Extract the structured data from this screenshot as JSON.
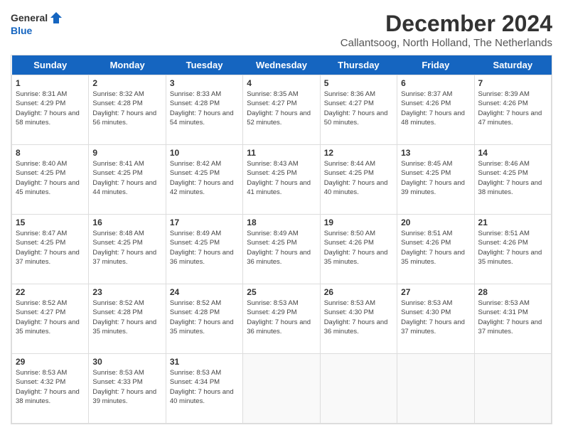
{
  "logo": {
    "general": "General",
    "blue": "Blue"
  },
  "title": "December 2024",
  "subtitle": "Callantsoog, North Holland, The Netherlands",
  "headers": [
    "Sunday",
    "Monday",
    "Tuesday",
    "Wednesday",
    "Thursday",
    "Friday",
    "Saturday"
  ],
  "weeks": [
    [
      {
        "day": "1",
        "sunrise": "8:31 AM",
        "sunset": "4:29 PM",
        "daylight": "7 hours and 58 minutes."
      },
      {
        "day": "2",
        "sunrise": "8:32 AM",
        "sunset": "4:28 PM",
        "daylight": "7 hours and 56 minutes."
      },
      {
        "day": "3",
        "sunrise": "8:33 AM",
        "sunset": "4:28 PM",
        "daylight": "7 hours and 54 minutes."
      },
      {
        "day": "4",
        "sunrise": "8:35 AM",
        "sunset": "4:27 PM",
        "daylight": "7 hours and 52 minutes."
      },
      {
        "day": "5",
        "sunrise": "8:36 AM",
        "sunset": "4:27 PM",
        "daylight": "7 hours and 50 minutes."
      },
      {
        "day": "6",
        "sunrise": "8:37 AM",
        "sunset": "4:26 PM",
        "daylight": "7 hours and 48 minutes."
      },
      {
        "day": "7",
        "sunrise": "8:39 AM",
        "sunset": "4:26 PM",
        "daylight": "7 hours and 47 minutes."
      }
    ],
    [
      {
        "day": "8",
        "sunrise": "8:40 AM",
        "sunset": "4:25 PM",
        "daylight": "7 hours and 45 minutes."
      },
      {
        "day": "9",
        "sunrise": "8:41 AM",
        "sunset": "4:25 PM",
        "daylight": "7 hours and 44 minutes."
      },
      {
        "day": "10",
        "sunrise": "8:42 AM",
        "sunset": "4:25 PM",
        "daylight": "7 hours and 42 minutes."
      },
      {
        "day": "11",
        "sunrise": "8:43 AM",
        "sunset": "4:25 PM",
        "daylight": "7 hours and 41 minutes."
      },
      {
        "day": "12",
        "sunrise": "8:44 AM",
        "sunset": "4:25 PM",
        "daylight": "7 hours and 40 minutes."
      },
      {
        "day": "13",
        "sunrise": "8:45 AM",
        "sunset": "4:25 PM",
        "daylight": "7 hours and 39 minutes."
      },
      {
        "day": "14",
        "sunrise": "8:46 AM",
        "sunset": "4:25 PM",
        "daylight": "7 hours and 38 minutes."
      }
    ],
    [
      {
        "day": "15",
        "sunrise": "8:47 AM",
        "sunset": "4:25 PM",
        "daylight": "7 hours and 37 minutes."
      },
      {
        "day": "16",
        "sunrise": "8:48 AM",
        "sunset": "4:25 PM",
        "daylight": "7 hours and 37 minutes."
      },
      {
        "day": "17",
        "sunrise": "8:49 AM",
        "sunset": "4:25 PM",
        "daylight": "7 hours and 36 minutes."
      },
      {
        "day": "18",
        "sunrise": "8:49 AM",
        "sunset": "4:25 PM",
        "daylight": "7 hours and 36 minutes."
      },
      {
        "day": "19",
        "sunrise": "8:50 AM",
        "sunset": "4:26 PM",
        "daylight": "7 hours and 35 minutes."
      },
      {
        "day": "20",
        "sunrise": "8:51 AM",
        "sunset": "4:26 PM",
        "daylight": "7 hours and 35 minutes."
      },
      {
        "day": "21",
        "sunrise": "8:51 AM",
        "sunset": "4:26 PM",
        "daylight": "7 hours and 35 minutes."
      }
    ],
    [
      {
        "day": "22",
        "sunrise": "8:52 AM",
        "sunset": "4:27 PM",
        "daylight": "7 hours and 35 minutes."
      },
      {
        "day": "23",
        "sunrise": "8:52 AM",
        "sunset": "4:28 PM",
        "daylight": "7 hours and 35 minutes."
      },
      {
        "day": "24",
        "sunrise": "8:52 AM",
        "sunset": "4:28 PM",
        "daylight": "7 hours and 35 minutes."
      },
      {
        "day": "25",
        "sunrise": "8:53 AM",
        "sunset": "4:29 PM",
        "daylight": "7 hours and 36 minutes."
      },
      {
        "day": "26",
        "sunrise": "8:53 AM",
        "sunset": "4:30 PM",
        "daylight": "7 hours and 36 minutes."
      },
      {
        "day": "27",
        "sunrise": "8:53 AM",
        "sunset": "4:30 PM",
        "daylight": "7 hours and 37 minutes."
      },
      {
        "day": "28",
        "sunrise": "8:53 AM",
        "sunset": "4:31 PM",
        "daylight": "7 hours and 37 minutes."
      }
    ],
    [
      {
        "day": "29",
        "sunrise": "8:53 AM",
        "sunset": "4:32 PM",
        "daylight": "7 hours and 38 minutes."
      },
      {
        "day": "30",
        "sunrise": "8:53 AM",
        "sunset": "4:33 PM",
        "daylight": "7 hours and 39 minutes."
      },
      {
        "day": "31",
        "sunrise": "8:53 AM",
        "sunset": "4:34 PM",
        "daylight": "7 hours and 40 minutes."
      },
      null,
      null,
      null,
      null
    ]
  ]
}
